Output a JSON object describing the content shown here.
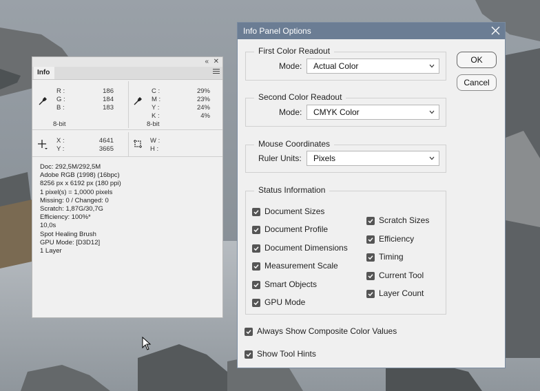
{
  "info_panel": {
    "tab_label": "Info",
    "first_readout": {
      "labels": [
        "R :",
        "G :",
        "B :"
      ],
      "values": [
        "186",
        "184",
        "183"
      ],
      "bitdepth": "8-bit"
    },
    "second_readout": {
      "labels": [
        "C :",
        "M :",
        "Y :",
        "K :"
      ],
      "values": [
        "29%",
        "23%",
        "24%",
        "4%"
      ],
      "bitdepth": "8-bit"
    },
    "coords": {
      "x_label": "X :",
      "x_value": "4641",
      "y_label": "Y :",
      "y_value": "3665",
      "w_label": "W :",
      "h_label": "H :"
    },
    "doc_lines": [
      "Doc: 292,5M/292,5M",
      "Adobe RGB (1998) (16bpc)",
      "8256 px x 6192 px (180 ppi)",
      "1 pixel(s) = 1,0000 pixels",
      "Missing: 0 / Changed: 0",
      "Scratch: 1,87G/30,7G",
      "Efficiency: 100%*",
      "10,0s",
      "Spot Healing Brush",
      "GPU Mode: [D3D12]",
      "1 Layer"
    ]
  },
  "dialog": {
    "title": "Info Panel Options",
    "ok_label": "OK",
    "cancel_label": "Cancel",
    "first_color": {
      "title": "First Color Readout",
      "mode_label": "Mode:",
      "mode_value": "Actual Color"
    },
    "second_color": {
      "title": "Second Color Readout",
      "mode_label": "Mode:",
      "mode_value": "CMYK Color"
    },
    "mouse": {
      "title": "Mouse Coordinates",
      "units_label": "Ruler Units:",
      "units_value": "Pixels"
    },
    "status": {
      "title": "Status Information",
      "left": [
        "Document Sizes",
        "Document Profile",
        "Document Dimensions",
        "Measurement Scale",
        "Smart Objects",
        "GPU Mode"
      ],
      "right": [
        "Scratch Sizes",
        "Efficiency",
        "Timing",
        "Current Tool",
        "Layer Count"
      ]
    },
    "always_composite": "Always Show Composite Color Values",
    "show_tool_hints": "Show Tool Hints"
  }
}
